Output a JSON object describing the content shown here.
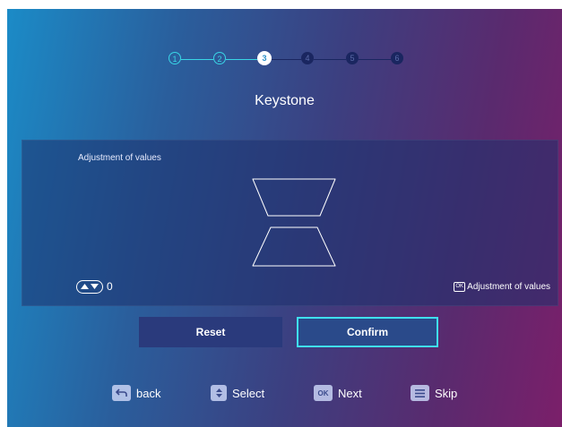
{
  "stepper": {
    "steps": [
      "1",
      "2",
      "3",
      "4",
      "5",
      "6"
    ],
    "current": 3
  },
  "title": "Keystone",
  "panel": {
    "label": "Adjustment of values",
    "value": "0",
    "ok_hint": "Adjustment of values",
    "ok_icon_text": "OK"
  },
  "buttons": {
    "reset": "Reset",
    "confirm": "Confirm"
  },
  "hints": {
    "back": "back",
    "select": "Select",
    "next": "Next",
    "skip": "Skip",
    "ok_icon_text": "OK"
  },
  "colors": {
    "accent": "#3fe0ee",
    "step_done": "#39d5e6",
    "step_todo": "#1a2660"
  }
}
